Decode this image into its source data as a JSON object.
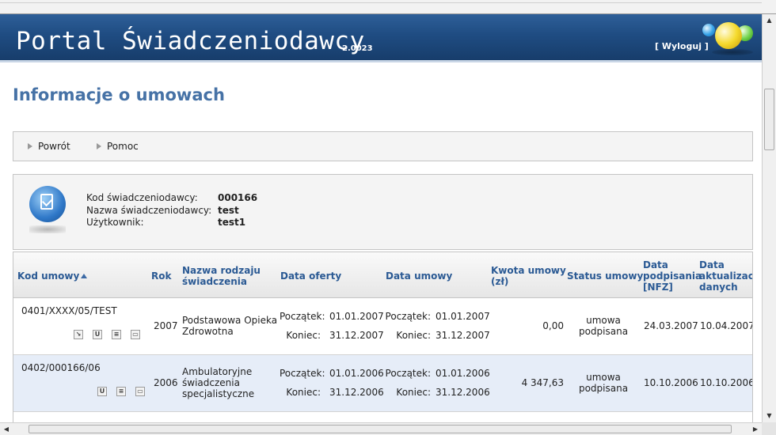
{
  "header": {
    "app_title": "Portal Świadczeniodawcy",
    "version": "2.0023",
    "logout_label": "[ Wyloguj ]"
  },
  "page_title": "Informacje o umowach",
  "toolbar": {
    "back_label": "Powrót",
    "help_label": "Pomoc"
  },
  "provider_info": {
    "code_label": "Kod świadczeniodawcy:",
    "code_value": "000166",
    "name_label": "Nazwa świadczeniodawcy:",
    "name_value": "test",
    "user_label": "Użytkownik:",
    "user_value": "test1"
  },
  "table": {
    "columns": {
      "kod_umowy": "Kod umowy",
      "rok": "Rok",
      "nazwa_rodzaju_1": "Nazwa rodzaju",
      "nazwa_rodzaju_2": "świadczenia",
      "data_oferty": "Data oferty",
      "data_umowy": "Data umowy",
      "kwota_1": "Kwota umowy",
      "kwota_2": "(zł)",
      "status": "Status umowy",
      "data_podpisania_1": "Data",
      "data_podpisania_2": "podpisania",
      "data_podpisania_3": "[NFZ]",
      "data_aktualizacji_1": "Data",
      "data_aktualizacji_2": "aktualizacji",
      "data_aktualizacji_3": "danych"
    },
    "start_label": "Początek:",
    "end_label": "Koniec:",
    "rows": [
      {
        "kod": "0401/XXXX/05/TEST",
        "rok": "2007",
        "nazwa_1": "Podstawowa Opieka",
        "nazwa_2": "Zdrowotna",
        "nazwa_3": "",
        "oferta_start": "01.01.2007",
        "oferta_end": "31.12.2007",
        "umowa_start": "01.01.2007",
        "umowa_end": "31.12.2007",
        "kwota": "0,00",
        "status_1": "umowa",
        "status_2": "podpisana",
        "data_podpisania": "24.03.2007",
        "data_aktualizacji": "10.04.2007"
      },
      {
        "kod": "0402/000166/06",
        "rok": "2006",
        "nazwa_1": "Ambulatoryjne",
        "nazwa_2": "świadczenia",
        "nazwa_3": "specjalistyczne",
        "oferta_start": "01.01.2006",
        "oferta_end": "31.12.2006",
        "umowa_start": "01.01.2006",
        "umowa_end": "31.12.2006",
        "kwota": "4 347,63",
        "status_1": "umowa",
        "status_2": "podpisana",
        "data_podpisania": "10.10.2006",
        "data_aktualizacji": "10.10.2006"
      }
    ],
    "action_icons": {
      "export": "↘",
      "u": "U",
      "list": "≡",
      "monitor": "▭"
    }
  },
  "colors": {
    "banner": "#1f4c82",
    "title": "#4672a6",
    "header_link": "#2b5a94",
    "alt_row": "#e6edf8"
  }
}
